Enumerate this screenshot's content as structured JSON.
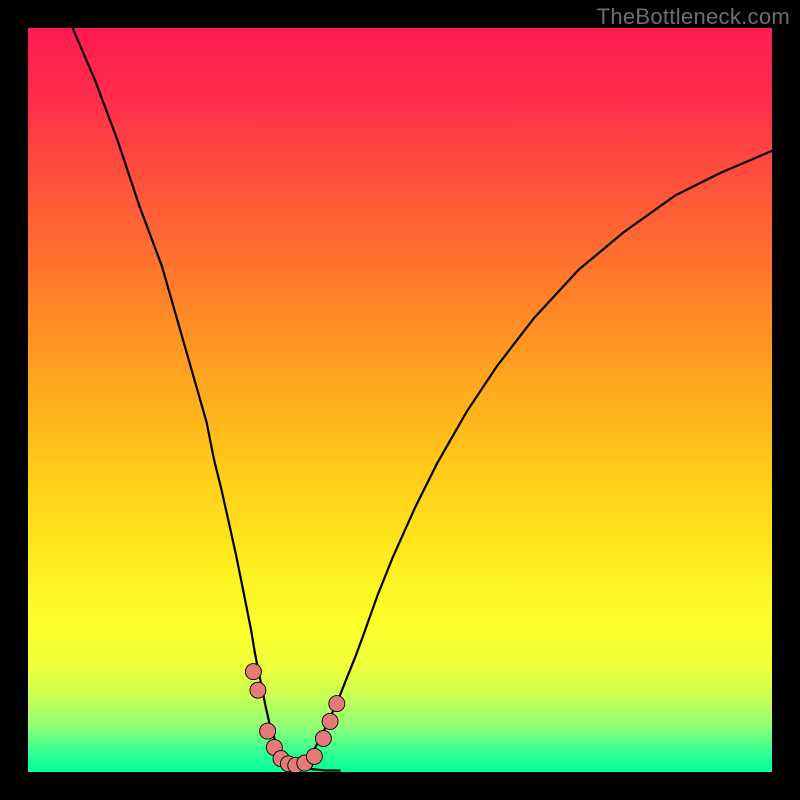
{
  "watermark": "TheBottleneck.com",
  "chart_data": {
    "type": "line",
    "title": "",
    "xlabel": "",
    "ylabel": "",
    "xlim": [
      0,
      100
    ],
    "ylim": [
      0,
      100
    ],
    "series": [
      {
        "name": "left-curve",
        "x": [
          6,
          9,
          12,
          15,
          18,
          20,
          22,
          24,
          25,
          26,
          27,
          28,
          29,
          30,
          30.5,
          31,
          31.5,
          32,
          32.6,
          33.3,
          34,
          35,
          36.5,
          38,
          40,
          42
        ],
        "y": [
          100,
          93,
          85,
          76,
          68,
          61,
          54,
          47,
          42,
          38,
          33.5,
          29,
          24,
          19,
          16,
          13.5,
          11,
          8.5,
          6,
          4,
          2.5,
          1.5,
          0.8,
          0.4,
          0.2,
          0.2
        ]
      },
      {
        "name": "right-curve",
        "x": [
          35,
          36,
          37,
          38,
          39,
          40,
          41,
          42,
          43,
          44,
          45,
          47,
          49,
          52,
          55,
          59,
          63,
          68,
          74,
          80,
          87,
          93,
          100
        ],
        "y": [
          0.2,
          0.4,
          1.0,
          2.2,
          4.0,
          6.0,
          8.2,
          10.5,
          13.0,
          15.5,
          18.2,
          23.8,
          28.8,
          35.5,
          41.5,
          48.5,
          54.5,
          61.0,
          67.5,
          72.5,
          77.5,
          80.5,
          83.5
        ]
      }
    ],
    "points": {
      "name": "marker-dots",
      "x": [
        30.3,
        30.9,
        32.2,
        33.1,
        34.0,
        35.0,
        36.0,
        37.2,
        38.5,
        39.7,
        40.6,
        41.5
      ],
      "y": [
        13.5,
        11.0,
        5.5,
        3.3,
        1.8,
        1.1,
        0.9,
        1.2,
        2.1,
        4.5,
        6.8,
        9.2
      ],
      "r": 8
    },
    "gradient_stops": [
      {
        "pos": 0,
        "color": "#ff1a52"
      },
      {
        "pos": 10,
        "color": "#ff2f4a"
      },
      {
        "pos": 22,
        "color": "#ff5639"
      },
      {
        "pos": 34,
        "color": "#ff7a2a"
      },
      {
        "pos": 46,
        "color": "#ffa21f"
      },
      {
        "pos": 58,
        "color": "#ffc71a"
      },
      {
        "pos": 70,
        "color": "#ffe81c"
      },
      {
        "pos": 80,
        "color": "#fdff2a"
      },
      {
        "pos": 86,
        "color": "#eeff3a"
      },
      {
        "pos": 90,
        "color": "#c8ff55"
      },
      {
        "pos": 94,
        "color": "#8eff76"
      },
      {
        "pos": 97,
        "color": "#3bff90"
      },
      {
        "pos": 100,
        "color": "#00ff9c"
      }
    ]
  }
}
